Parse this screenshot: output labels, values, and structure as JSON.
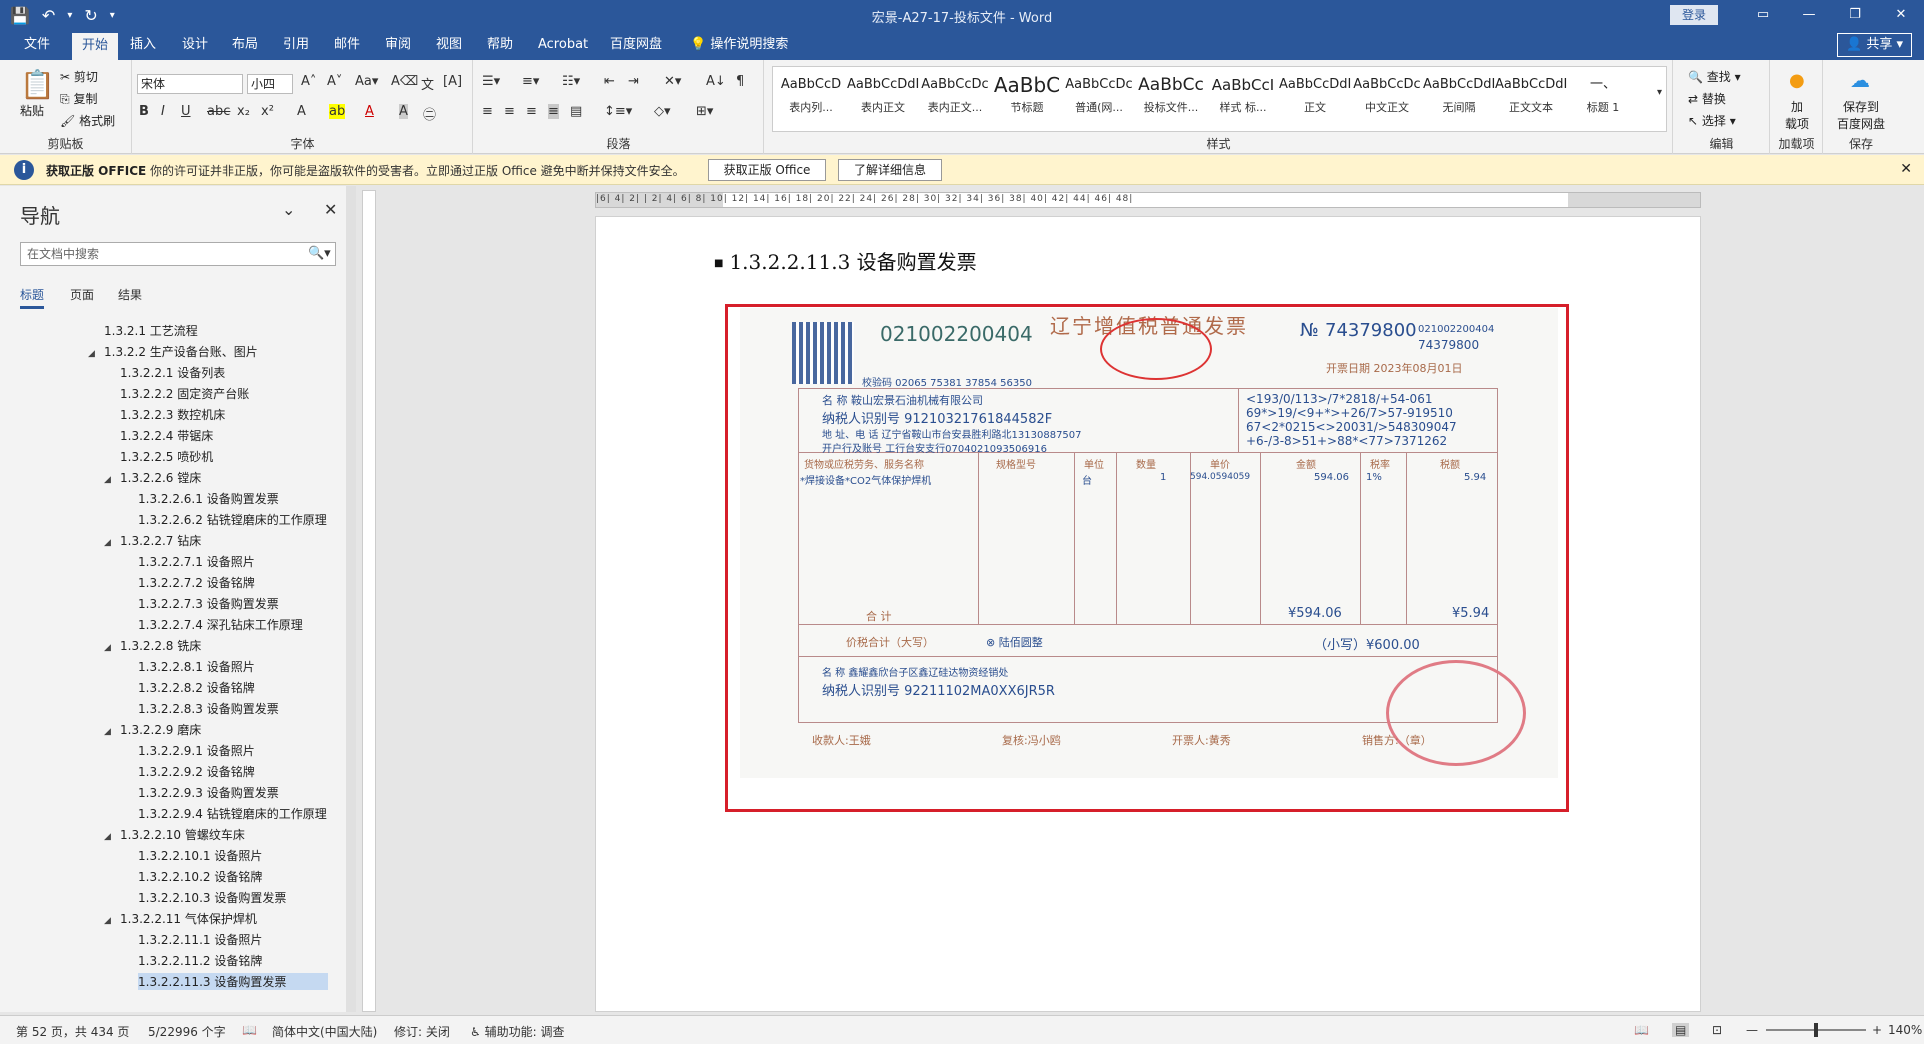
{
  "titlebar": {
    "document_title": "宏景-A27-17-投标文件 - Word",
    "login": "登录"
  },
  "tabs": [
    "文件",
    "开始",
    "插入",
    "设计",
    "布局",
    "引用",
    "邮件",
    "审阅",
    "视图",
    "帮助",
    "Acrobat",
    "百度网盘",
    "操作说明搜索"
  ],
  "share": "共享",
  "ribbon": {
    "clipboard": {
      "label": "剪贴板",
      "paste": "粘贴",
      "cut": "剪切",
      "copy": "复制",
      "format_painter": "格式刷"
    },
    "font": {
      "label": "字体",
      "name": "宋体",
      "size": "小四"
    },
    "paragraph": {
      "label": "段落"
    },
    "styles": {
      "label": "样式",
      "items": [
        {
          "preview": "AaBbCcD",
          "name": "表内列..."
        },
        {
          "preview": "AaBbCcDdI",
          "name": "表内正文"
        },
        {
          "preview": "AaBbCcDc",
          "name": "表内正文..."
        },
        {
          "preview": "AaBbC",
          "name": "节标题"
        },
        {
          "preview": "AaBbCcDc",
          "name": "普通(网..."
        },
        {
          "preview": "AaBbCc",
          "name": "投标文件..."
        },
        {
          "preview": "AaBbCcI",
          "name": "样式 标..."
        },
        {
          "preview": "AaBbCcDdI",
          "name": "正文"
        },
        {
          "preview": "AaBbCcDc",
          "name": "中文正文"
        },
        {
          "preview": "AaBbCcDdI",
          "name": "无间隔"
        },
        {
          "preview": "AaBbCcDdI",
          "name": "正文文本"
        },
        {
          "preview": "一、",
          "name": "标题 1"
        }
      ]
    },
    "editing": {
      "label": "编辑",
      "find": "查找",
      "replace": "替换",
      "select": "选择"
    },
    "addins": {
      "label": "加载项",
      "button": "加\n载项"
    },
    "save": {
      "label": "保存",
      "button": "保存到\n百度网盘"
    }
  },
  "msgbar": {
    "title": "获取正版 OFFICE",
    "text": "你的许可证并非正版，你可能是盗版软件的受害者。立即通过正版 Office 避免中断并保持文件安全。",
    "btn1": "获取正版 Office",
    "btn2": "了解详细信息"
  },
  "nav": {
    "title": "导航",
    "search_placeholder": "在文档中搜索",
    "tabs": [
      "标题",
      "页面",
      "结果"
    ],
    "items": [
      {
        "label": "1.3.2.1 工艺流程",
        "level": 0,
        "tri": ""
      },
      {
        "label": "1.3.2.2 生产设备台账、图片",
        "level": 0,
        "tri": "◢"
      },
      {
        "label": "1.3.2.2.1 设备列表",
        "level": 1,
        "tri": ""
      },
      {
        "label": "1.3.2.2.2 固定资产台账",
        "level": 1,
        "tri": ""
      },
      {
        "label": "1.3.2.2.3 数控机床",
        "level": 1,
        "tri": ""
      },
      {
        "label": "1.3.2.2.4 带锯床",
        "level": 1,
        "tri": ""
      },
      {
        "label": "1.3.2.2.5 喷砂机",
        "level": 1,
        "tri": ""
      },
      {
        "label": "1.3.2.2.6 镗床",
        "level": 1,
        "tri": "◢"
      },
      {
        "label": "1.3.2.2.6.1 设备购置发票",
        "level": 2,
        "tri": ""
      },
      {
        "label": "1.3.2.2.6.2 钻铣镗磨床的工作原理",
        "level": 2,
        "tri": ""
      },
      {
        "label": "1.3.2.2.7 钻床",
        "level": 1,
        "tri": "◢"
      },
      {
        "label": "1.3.2.2.7.1 设备照片",
        "level": 2,
        "tri": ""
      },
      {
        "label": "1.3.2.2.7.2 设备铭牌",
        "level": 2,
        "tri": ""
      },
      {
        "label": "1.3.2.2.7.3 设备购置发票",
        "level": 2,
        "tri": ""
      },
      {
        "label": "1.3.2.2.7.4 深孔钻床工作原理",
        "level": 2,
        "tri": ""
      },
      {
        "label": "1.3.2.2.8 铣床",
        "level": 1,
        "tri": "◢"
      },
      {
        "label": "1.3.2.2.8.1 设备照片",
        "level": 2,
        "tri": ""
      },
      {
        "label": "1.3.2.2.8.2 设备铭牌",
        "level": 2,
        "tri": ""
      },
      {
        "label": "1.3.2.2.8.3 设备购置发票",
        "level": 2,
        "tri": ""
      },
      {
        "label": "1.3.2.2.9 磨床",
        "level": 1,
        "tri": "◢"
      },
      {
        "label": "1.3.2.2.9.1 设备照片",
        "level": 2,
        "tri": ""
      },
      {
        "label": "1.3.2.2.9.2 设备铭牌",
        "level": 2,
        "tri": ""
      },
      {
        "label": "1.3.2.2.9.3 设备购置发票",
        "level": 2,
        "tri": ""
      },
      {
        "label": "1.3.2.2.9.4 钻铣镗磨床的工作原理",
        "level": 2,
        "tri": ""
      },
      {
        "label": "1.3.2.2.10 管螺纹车床",
        "level": 1,
        "tri": "◢"
      },
      {
        "label": "1.3.2.2.10.1 设备照片",
        "level": 2,
        "tri": ""
      },
      {
        "label": "1.3.2.2.10.2 设备铭牌",
        "level": 2,
        "tri": ""
      },
      {
        "label": "1.3.2.2.10.3 设备购置发票",
        "level": 2,
        "tri": ""
      },
      {
        "label": "1.3.2.2.11 气体保护焊机",
        "level": 1,
        "tri": "◢"
      },
      {
        "label": "1.3.2.2.11.1 设备照片",
        "level": 2,
        "tri": ""
      },
      {
        "label": "1.3.2.2.11.2 设备铭牌",
        "level": 2,
        "tri": ""
      },
      {
        "label": "1.3.2.2.11.3 设备购置发票",
        "level": 2,
        "tri": "",
        "selected": true
      }
    ]
  },
  "doc": {
    "heading": "1.3.2.2.11.3  设备购置发票",
    "invoice": {
      "code": "021002200404",
      "title": "辽宁增值税普通发票",
      "no_label": "№",
      "number": "74379800",
      "code_small": "021002200404",
      "number_small": "74379800",
      "date": "开票日期 2023年08月01日",
      "check_code": "校验码 02065 75381 37854 56350",
      "buyer_name": "名  称  鞍山宏景石油机械有限公司",
      "buyer_tax": "纳税人识别号  91210321761844582F",
      "buyer_addr": "地 址、电 话 辽宁省鞍山市台安县胜利路北13130887507",
      "buyer_bank": "开户行及账号 工行台安支行0704021093506916",
      "cipher": [
        "<193/0/113>/7*2818/+54-061",
        "69*>19/<9+*>+26/7>57-919510",
        "67<2*0215<>20031/>548309047",
        "+6-/3-8>51+>88*<77>7371262"
      ],
      "headers": [
        "货物或应税劳务、服务名称",
        "规格型号",
        "单位",
        "数量",
        "单价",
        "金额",
        "税率",
        "税额"
      ],
      "item": "*焊接设备*CO2气体保护焊机",
      "unit": "台",
      "qty": "1",
      "price": "594.0594059",
      "amount": "594.06",
      "rate": "1%",
      "tax": "5.94",
      "total_label": "合    计",
      "total_amount": "¥594.06",
      "total_tax": "¥5.94",
      "sum_words_label": "价税合计（大写）",
      "sum_words": "⊗ 陆佰圆整",
      "sum_small": "（小写）¥600.00",
      "seller_name": "名  称  鑫耀鑫欣台子区鑫辽硅达物资经销处",
      "seller_tax": "纳税人识别号  92211102MA0XX6JR5R",
      "payee": "收款人:王娥",
      "reviewer": "复核:冯小鸥",
      "issuer": "开票人:黄秀",
      "seller_sign": "销售方:（章）"
    }
  },
  "status": {
    "page": "第 52 页，共 434 页",
    "words": "5/22996 个字",
    "lang": "简体中文(中国大陆)",
    "track": "修订: 关闭",
    "access": "辅助功能: 调查",
    "zoom": "140%"
  }
}
